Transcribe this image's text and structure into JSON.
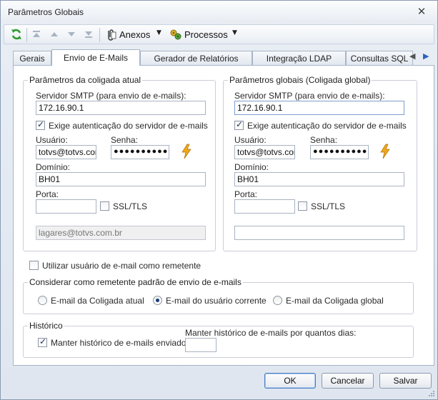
{
  "window": {
    "title": "Parâmetros Globais",
    "close_glyph": "✕"
  },
  "toolbar": {
    "icons": [
      "refresh-icon",
      "first-record-icon",
      "previous-record-icon",
      "next-record-icon",
      "last-record-icon",
      "attachments-icon",
      "processes-icon"
    ],
    "anexos_label": "Anexos",
    "processos_label": "Processos",
    "dropdown_glyph": "▼"
  },
  "tabs": [
    {
      "label": "Gerais"
    },
    {
      "label": "Envio de E-Mails"
    },
    {
      "label": "Gerador de Relatórios"
    },
    {
      "label": "Integração LDAP"
    },
    {
      "label": "Consultas SQL"
    }
  ],
  "tab_scroll": {
    "left": "◀",
    "right": "▶"
  },
  "current": {
    "title": "Parâmetros da coligada atual",
    "smtp_label": "Servidor SMTP (para envio de e-mails):",
    "smtp_value": "172.16.90.1",
    "auth_label": "Exige autenticação do servidor de e-mails",
    "auth_checked": true,
    "user_label": "Usuário:",
    "user_value": "totvs@totvs.com",
    "password_label": "Senha:",
    "password_value": "●●●●●●●●●●●",
    "domain_label": "Domínio:",
    "domain_value": "BH01",
    "port_label": "Porta:",
    "port_value": "",
    "ssl_label": "SSL/TLS",
    "ssl_checked": false,
    "sender_value": "lagares@totvs.com.br"
  },
  "global": {
    "title": "Parâmetros globais (Coligada global)",
    "smtp_label": "Servidor SMTP (para envio de e-mails):",
    "smtp_value": "172.16.90.1",
    "auth_label": "Exige autenticação do servidor de e-mails",
    "auth_checked": true,
    "user_label": "Usuário:",
    "user_value": "totvs@totvs.com",
    "password_label": "Senha:",
    "password_value": "●●●●●●●●●●●",
    "domain_label": "Domínio:",
    "domain_value": "BH01",
    "port_label": "Porta:",
    "port_value": "",
    "ssl_label": "SSL/TLS",
    "ssl_checked": false,
    "sender_value": ""
  },
  "use_user_email_label": "Utilizar usuário de e-mail como remetente",
  "use_user_email_checked": false,
  "sender_group": {
    "title": "Considerar como remetente padrão de envio de e-mails",
    "options": [
      {
        "label": "E-mail da Coligada atual",
        "checked": false
      },
      {
        "label": "E-mail do usuário corrente",
        "checked": true
      },
      {
        "label": "E-mail da Coligada global",
        "checked": false
      }
    ]
  },
  "history": {
    "title": "Histórico",
    "keep_label": "Manter histórico de e-mails enviados",
    "keep_checked": true,
    "days_label": "Manter histórico de e-mails por quantos dias:",
    "days_value": ""
  },
  "buttons": {
    "ok": "OK",
    "cancel": "Cancelar",
    "save": "Salvar"
  },
  "colors": {
    "accent": "#4a7fc4",
    "bolt": "#f0a81a",
    "refresh": "#2e9a2e"
  }
}
